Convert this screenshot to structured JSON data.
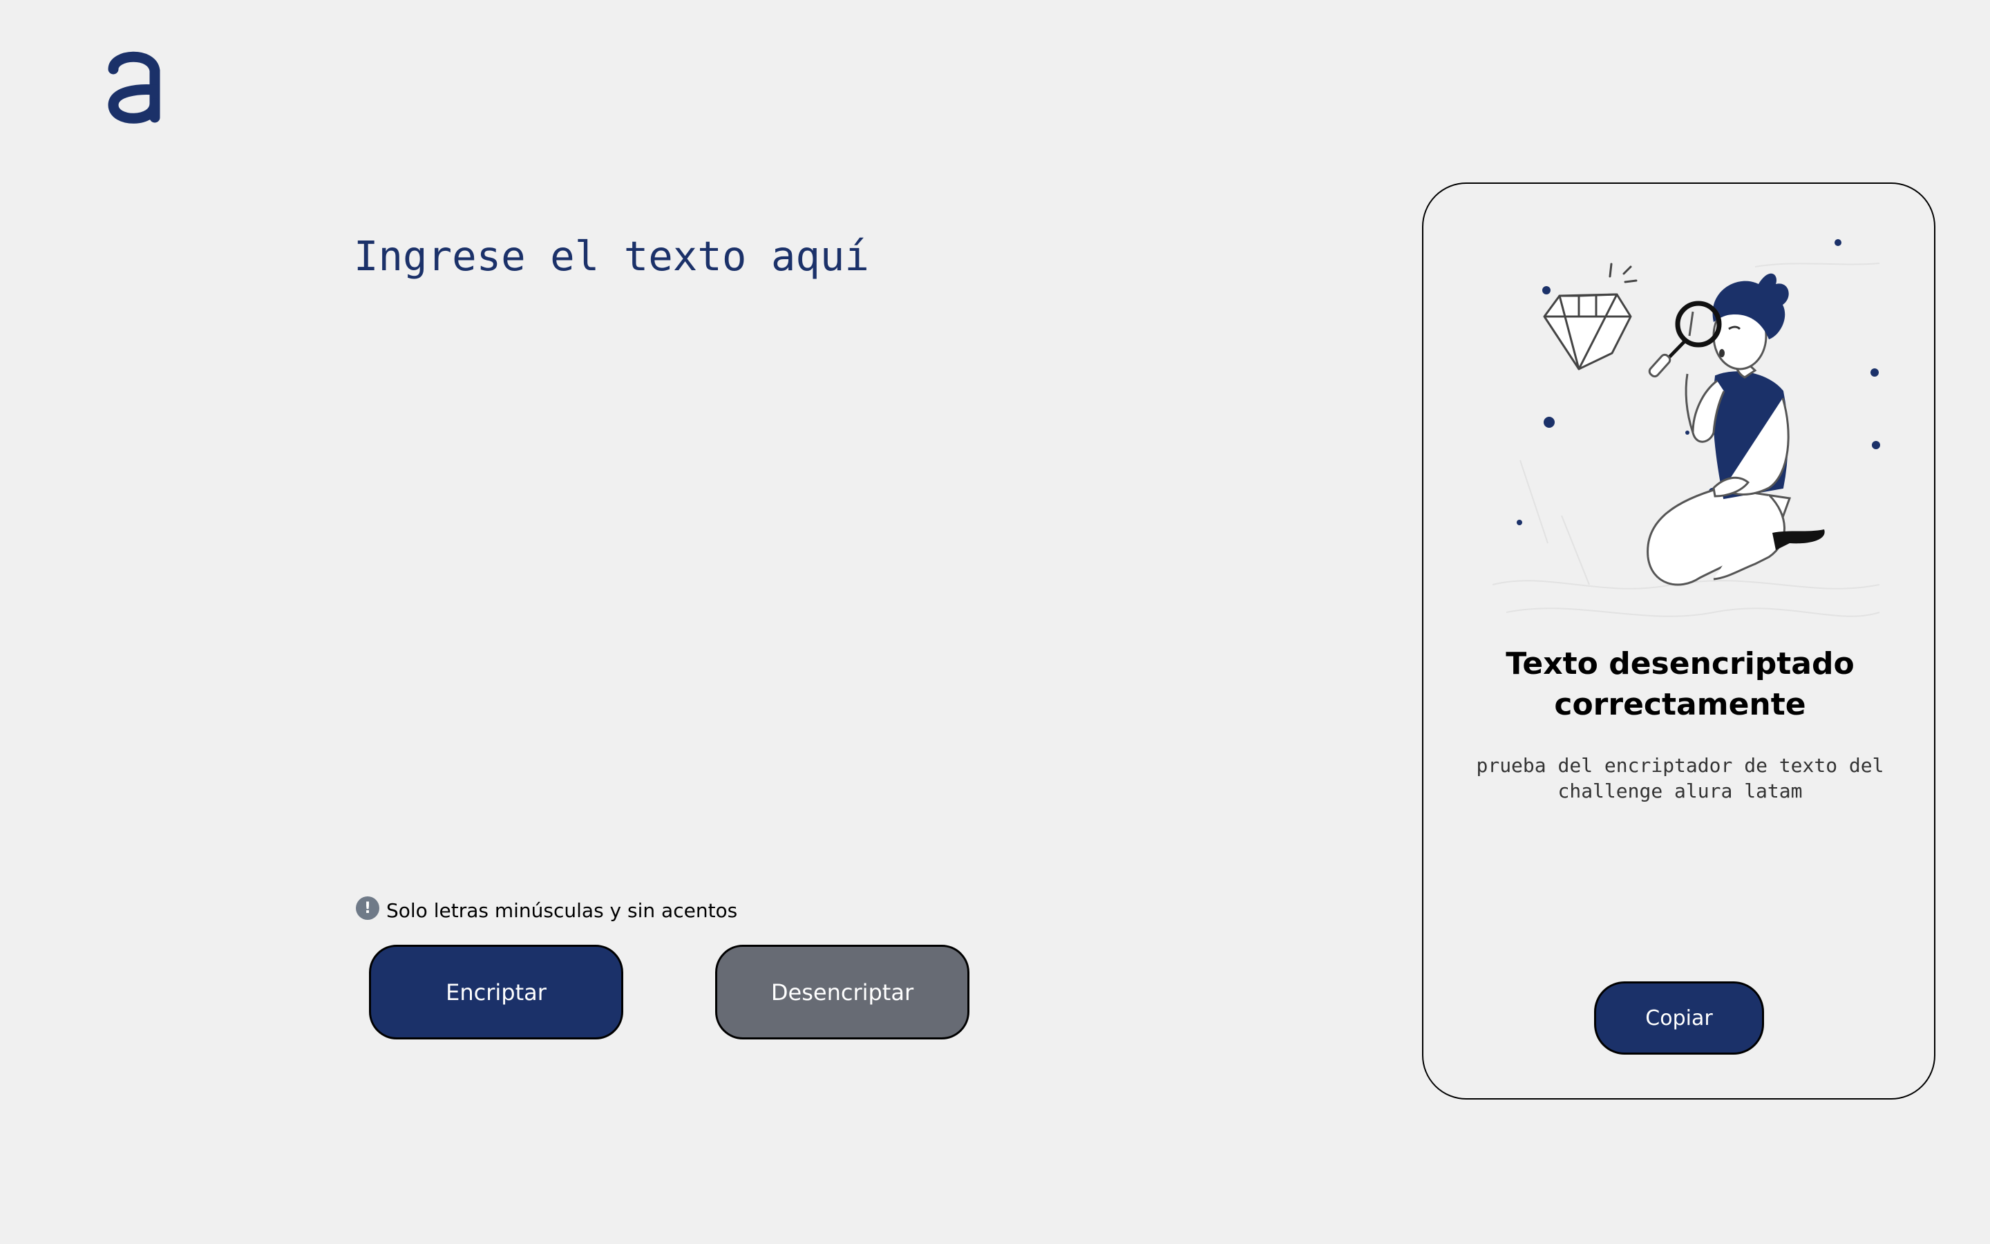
{
  "colors": {
    "accent": "#1b3169",
    "secondary_button": "#676b74",
    "background": "#f0f0f0",
    "hint_icon": "#6f7a88"
  },
  "logo": {
    "icon": "alura-a-logo-icon"
  },
  "input": {
    "value": "",
    "placeholder": "Ingrese el texto aquí"
  },
  "hint": {
    "icon": "exclamation-circle-icon",
    "icon_glyph": "!",
    "text": "Solo letras minúsculas y sin acentos"
  },
  "buttons": {
    "encrypt_label": "Encriptar",
    "decrypt_label": "Desencriptar"
  },
  "result": {
    "illustration": "person-with-magnifying-glass-and-diamond-illustration",
    "title": "Texto desencriptado correctamente",
    "message": "prueba del encriptador de texto del challenge alura latam",
    "copy_label": "Copiar"
  }
}
